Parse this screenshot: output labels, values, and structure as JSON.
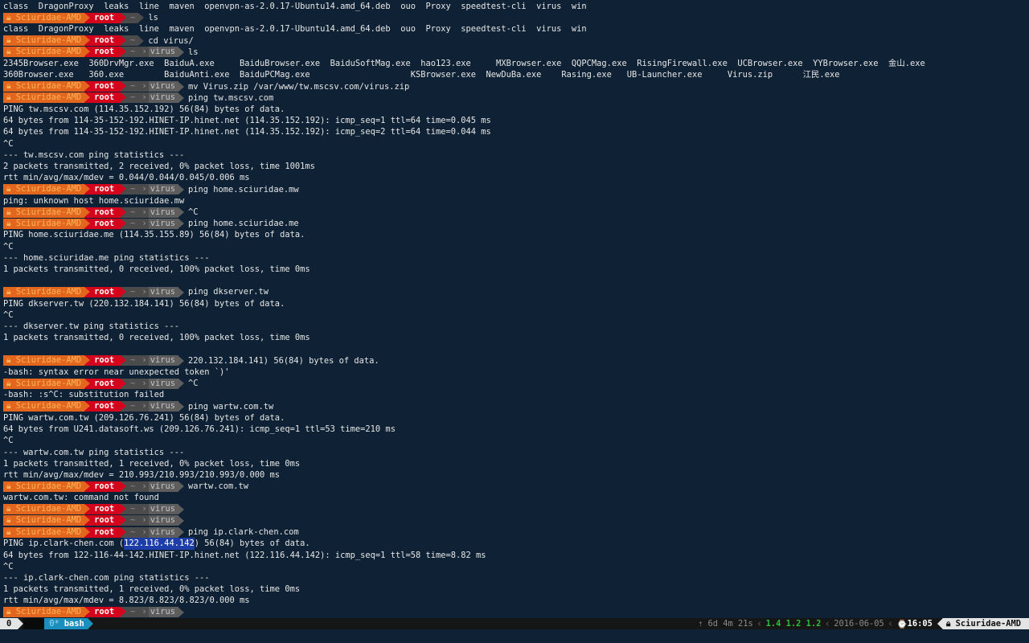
{
  "prompt": {
    "host": "Sciuridae-AMD",
    "user": "root",
    "home": "~",
    "colors": {
      "host_bg": "#e2661d",
      "host_fg": "#ffb45a",
      "user_bg": "#d4041c",
      "path_bg": "#4b4b4b",
      "dir_bg": "#5d5d5d",
      "background": "#0f2235"
    }
  },
  "lines": [
    {
      "type": "out",
      "text": "class  DragonProxy  leaks  line  maven  openvpn-as-2.0.17-Ubuntu14.amd_64.deb  ouo  Proxy  speedtest-cli  virus  win"
    },
    {
      "type": "prompt",
      "dir": "",
      "cmd": "ls"
    },
    {
      "type": "out",
      "text": "class  DragonProxy  leaks  line  maven  openvpn-as-2.0.17-Ubuntu14.amd_64.deb  ouo  Proxy  speedtest-cli  virus  win"
    },
    {
      "type": "prompt",
      "dir": "",
      "cmd": "cd virus/"
    },
    {
      "type": "prompt",
      "dir": "virus",
      "cmd": "ls"
    },
    {
      "type": "out",
      "text": "2345Browser.exe  360DrvMgr.exe  BaiduA.exe     BaiduBrowser.exe  BaiduSoftMag.exe  hao123.exe     MXBrowser.exe  QQPCMag.exe  RisingFirewall.exe  UCBrowser.exe  YYBrowser.exe  金山.exe"
    },
    {
      "type": "out",
      "text": "360Browser.exe   360.exe        BaiduAnti.exe  BaiduPCMag.exe                    KSBrowser.exe  NewDuBa.exe    Rasing.exe   UB-Launcher.exe     Virus.zip      江民.exe"
    },
    {
      "type": "prompt",
      "dir": "virus",
      "cmd": "mv Virus.zip /var/www/tw.mscsv.com/virus.zip"
    },
    {
      "type": "prompt",
      "dir": "virus",
      "cmd": "ping tw.mscsv.com"
    },
    {
      "type": "out",
      "text": "PING tw.mscsv.com (114.35.152.192) 56(84) bytes of data."
    },
    {
      "type": "out",
      "text": "64 bytes from 114-35-152-192.HINET-IP.hinet.net (114.35.152.192): icmp_seq=1 ttl=64 time=0.045 ms"
    },
    {
      "type": "out",
      "text": "64 bytes from 114-35-152-192.HINET-IP.hinet.net (114.35.152.192): icmp_seq=2 ttl=64 time=0.044 ms"
    },
    {
      "type": "out",
      "text": "^C"
    },
    {
      "type": "out",
      "text": "--- tw.mscsv.com ping statistics ---"
    },
    {
      "type": "out",
      "text": "2 packets transmitted, 2 received, 0% packet loss, time 1001ms"
    },
    {
      "type": "out",
      "text": "rtt min/avg/max/mdev = 0.044/0.044/0.045/0.006 ms"
    },
    {
      "type": "prompt",
      "dir": "virus",
      "cmd": "ping home.sciuridae.mw"
    },
    {
      "type": "out",
      "text": "ping: unknown host home.sciuridae.mw"
    },
    {
      "type": "prompt",
      "dir": "virus",
      "cmd": "^C"
    },
    {
      "type": "prompt",
      "dir": "virus",
      "cmd": "ping home.sciuridae.me"
    },
    {
      "type": "out",
      "text": "PING home.sciuridae.me (114.35.155.89) 56(84) bytes of data."
    },
    {
      "type": "out",
      "text": "^C"
    },
    {
      "type": "out",
      "text": "--- home.sciuridae.me ping statistics ---"
    },
    {
      "type": "out",
      "text": "1 packets transmitted, 0 received, 100% packet loss, time 0ms"
    },
    {
      "type": "out",
      "text": ""
    },
    {
      "type": "prompt",
      "dir": "virus",
      "cmd": "ping dkserver.tw"
    },
    {
      "type": "out",
      "text": "PING dkserver.tw (220.132.184.141) 56(84) bytes of data."
    },
    {
      "type": "out",
      "text": "^C"
    },
    {
      "type": "out",
      "text": "--- dkserver.tw ping statistics ---"
    },
    {
      "type": "out",
      "text": "1 packets transmitted, 0 received, 100% packet loss, time 0ms"
    },
    {
      "type": "out",
      "text": ""
    },
    {
      "type": "prompt",
      "dir": "virus",
      "cmd": "220.132.184.141) 56(84) bytes of data."
    },
    {
      "type": "out",
      "text": "-bash: syntax error near unexpected token `)'"
    },
    {
      "type": "prompt",
      "dir": "virus",
      "cmd": "^C"
    },
    {
      "type": "out",
      "text": "-bash: :s^C: substitution failed"
    },
    {
      "type": "prompt",
      "dir": "virus",
      "cmd": "ping wartw.com.tw"
    },
    {
      "type": "out",
      "text": "PING wartw.com.tw (209.126.76.241) 56(84) bytes of data."
    },
    {
      "type": "out",
      "text": "64 bytes from U241.datasoft.ws (209.126.76.241): icmp_seq=1 ttl=53 time=210 ms"
    },
    {
      "type": "out",
      "text": "^C"
    },
    {
      "type": "out",
      "text": "--- wartw.com.tw ping statistics ---"
    },
    {
      "type": "out",
      "text": "1 packets transmitted, 1 received, 0% packet loss, time 0ms"
    },
    {
      "type": "out",
      "text": "rtt min/avg/max/mdev = 210.993/210.993/210.993/0.000 ms"
    },
    {
      "type": "prompt",
      "dir": "virus",
      "cmd": "wartw.com.tw"
    },
    {
      "type": "out",
      "text": "wartw.com.tw: command not found"
    },
    {
      "type": "prompt",
      "dir": "virus",
      "cmd": ""
    },
    {
      "type": "prompt",
      "dir": "virus",
      "cmd": ""
    },
    {
      "type": "prompt",
      "dir": "virus",
      "cmd": "ping ip.clark-chen.com"
    },
    {
      "type": "out",
      "text": "PING ip.clark-chen.com (",
      "sel": "122.116.44.142",
      "post": ") 56(84) bytes of data."
    },
    {
      "type": "out",
      "text": "64 bytes from 122-116-44-142.HINET-IP.hinet.net (122.116.44.142): icmp_seq=1 ttl=58 time=8.82 ms"
    },
    {
      "type": "out",
      "text": "^C"
    },
    {
      "type": "out",
      "text": "--- ip.clark-chen.com ping statistics ---"
    },
    {
      "type": "out",
      "text": "1 packets transmitted, 1 received, 0% packet loss, time 0ms"
    },
    {
      "type": "out",
      "text": "rtt min/avg/max/mdev = 8.823/8.823/8.823/0.000 ms"
    },
    {
      "type": "prompt",
      "dir": "virus",
      "cmd": ""
    }
  ],
  "status": {
    "session": "0",
    "window_index": "0*",
    "window_name": "bash",
    "uptime_icon": "⇡",
    "uptime": "6d 4m 21s",
    "load": "1.4 1.2 1.2",
    "date": "2016-06-05",
    "clock_icon": "⌚",
    "time": "16:05",
    "hostname": "Sciuridae-AMD",
    "colors": {
      "load": "#2fbf3f",
      "window_bg": "#1a8fbd"
    }
  }
}
